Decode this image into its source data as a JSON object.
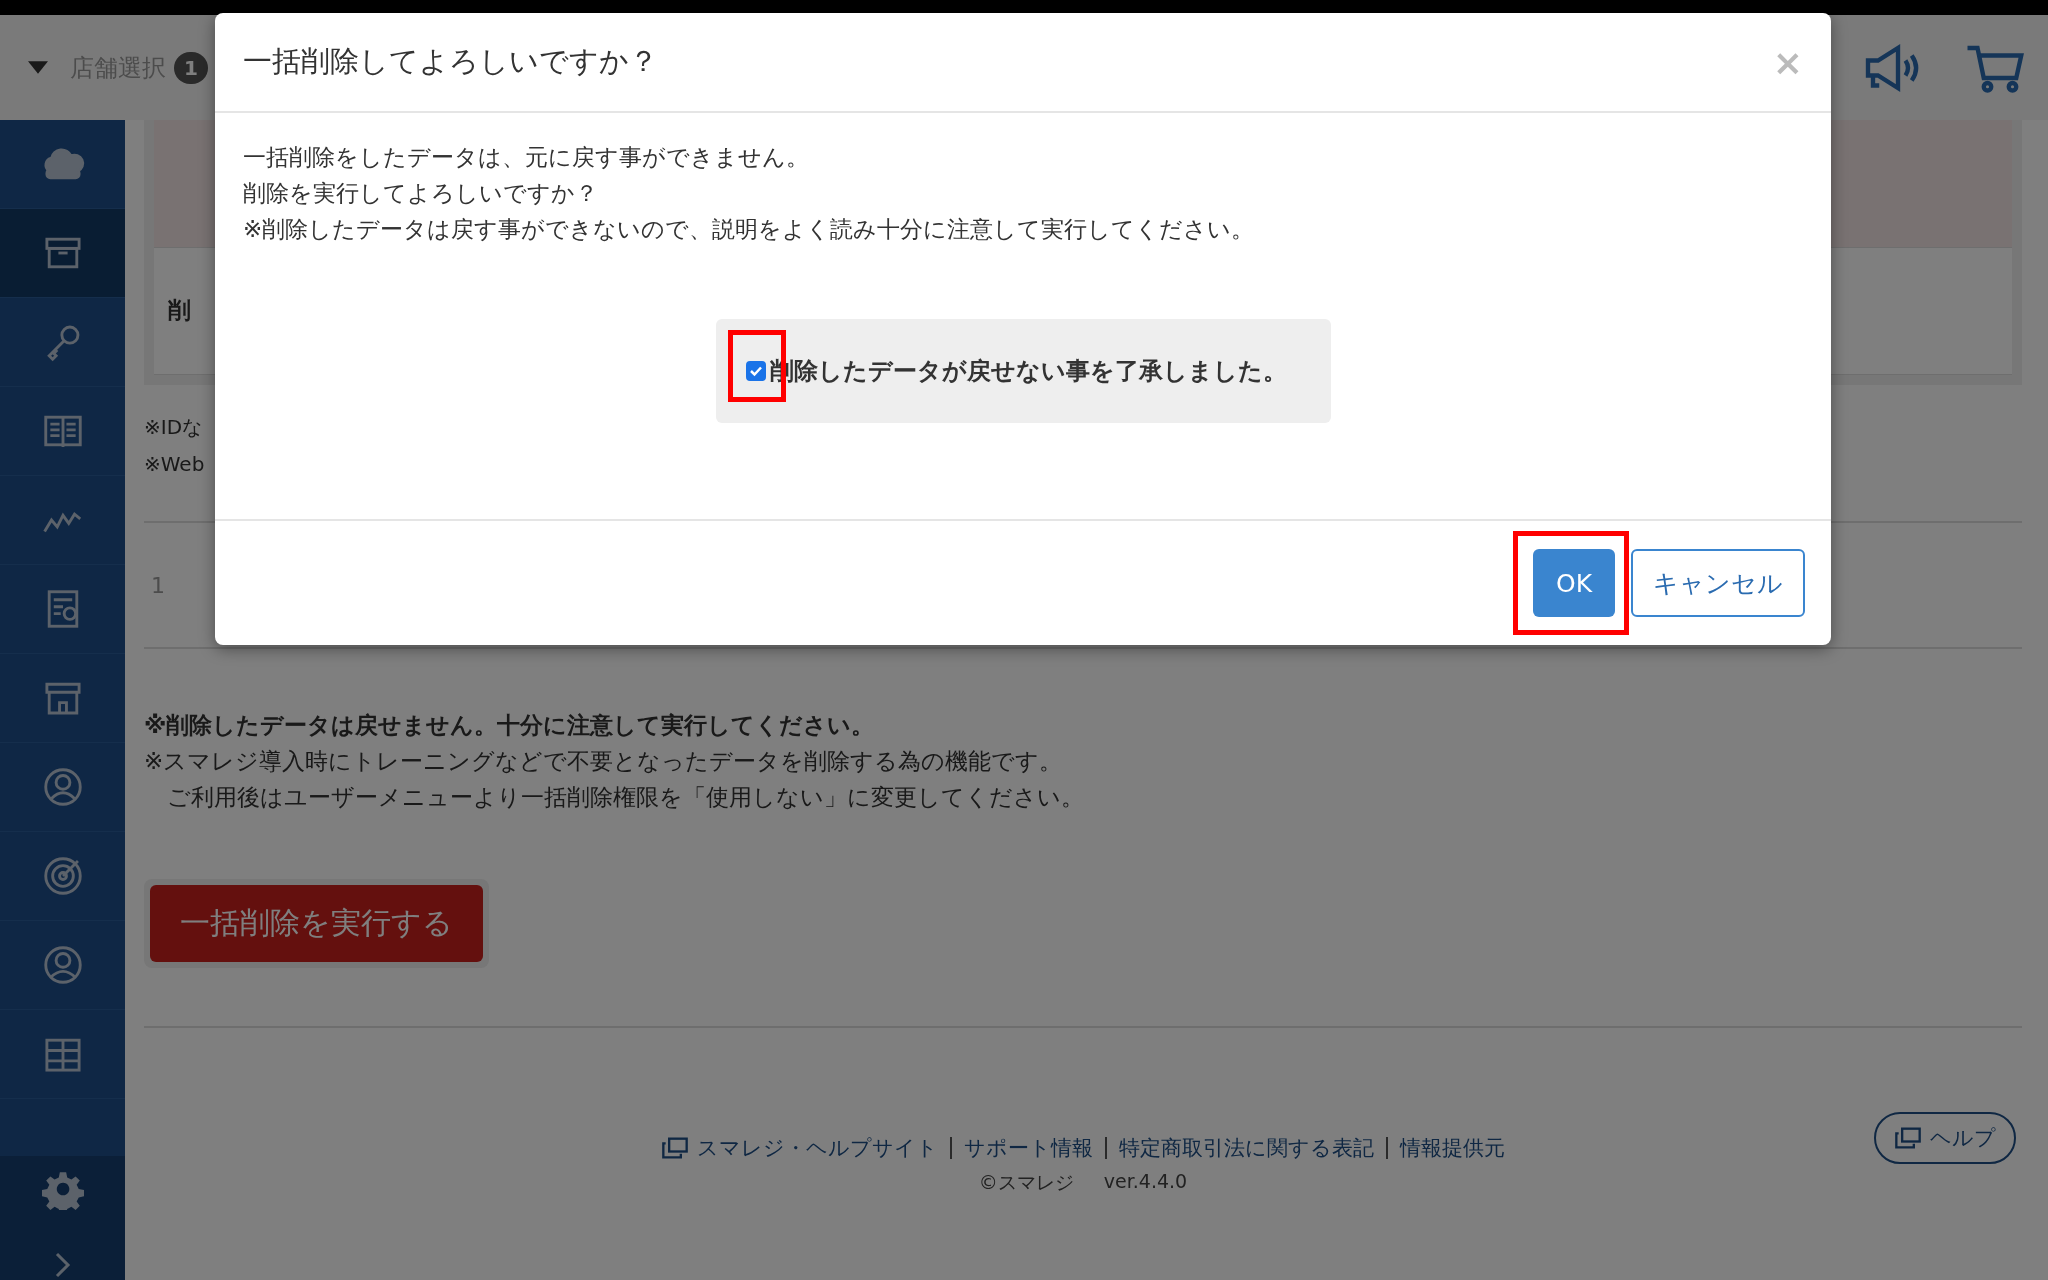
{
  "header": {
    "store_select": "店舗選択",
    "store_count": "1"
  },
  "sidebar": {
    "items": [
      {
        "kind": "cloud",
        "selected": false
      },
      {
        "kind": "box",
        "selected": true
      },
      {
        "kind": "key",
        "selected": false
      },
      {
        "kind": "book",
        "selected": false
      },
      {
        "kind": "chart",
        "selected": false
      },
      {
        "kind": "report",
        "selected": false
      },
      {
        "kind": "store",
        "selected": false
      },
      {
        "kind": "staff",
        "selected": false
      },
      {
        "kind": "target",
        "selected": false
      },
      {
        "kind": "user",
        "selected": false
      },
      {
        "kind": "grid",
        "selected": false
      }
    ]
  },
  "main": {
    "table_label": "削",
    "notes_cut": [
      "※IDな",
      "※Web"
    ],
    "row_number": "1",
    "warning": "※削除したデータは戻せません。十分に注意して実行してください。",
    "notes": [
      "※スマレジ導入時にトレーニングなどで不要となったデータを削除する為の機能です。",
      "　ご利用後はユーザーメニューより一括削除権限を「使用しない」に変更してください。"
    ],
    "execute_button": "一括削除を実行する"
  },
  "footer": {
    "links": [
      "スマレジ・ヘルプサイト",
      "サポート情報",
      "特定商取引法に関する表記",
      "情報提供元"
    ],
    "copyright": "©スマレジ",
    "version": "ver.4.4.0",
    "help_button": "ヘルプ"
  },
  "dialog": {
    "title": "一括削除してよろしいですか？",
    "close": "×",
    "message": [
      "一括削除をしたデータは、元に戻す事ができません。",
      "削除を実行してよろしいですか？",
      "※削除したデータは戻す事ができないので、説明をよく読み十分に注意して実行してください。"
    ],
    "confirm": {
      "label": "削除したデータが戻せない事を了承しました。",
      "checked": true
    },
    "buttons": [
      {
        "label": "OK",
        "kind": "primary"
      },
      {
        "label": "キャンセル",
        "kind": "secondary"
      }
    ]
  }
}
